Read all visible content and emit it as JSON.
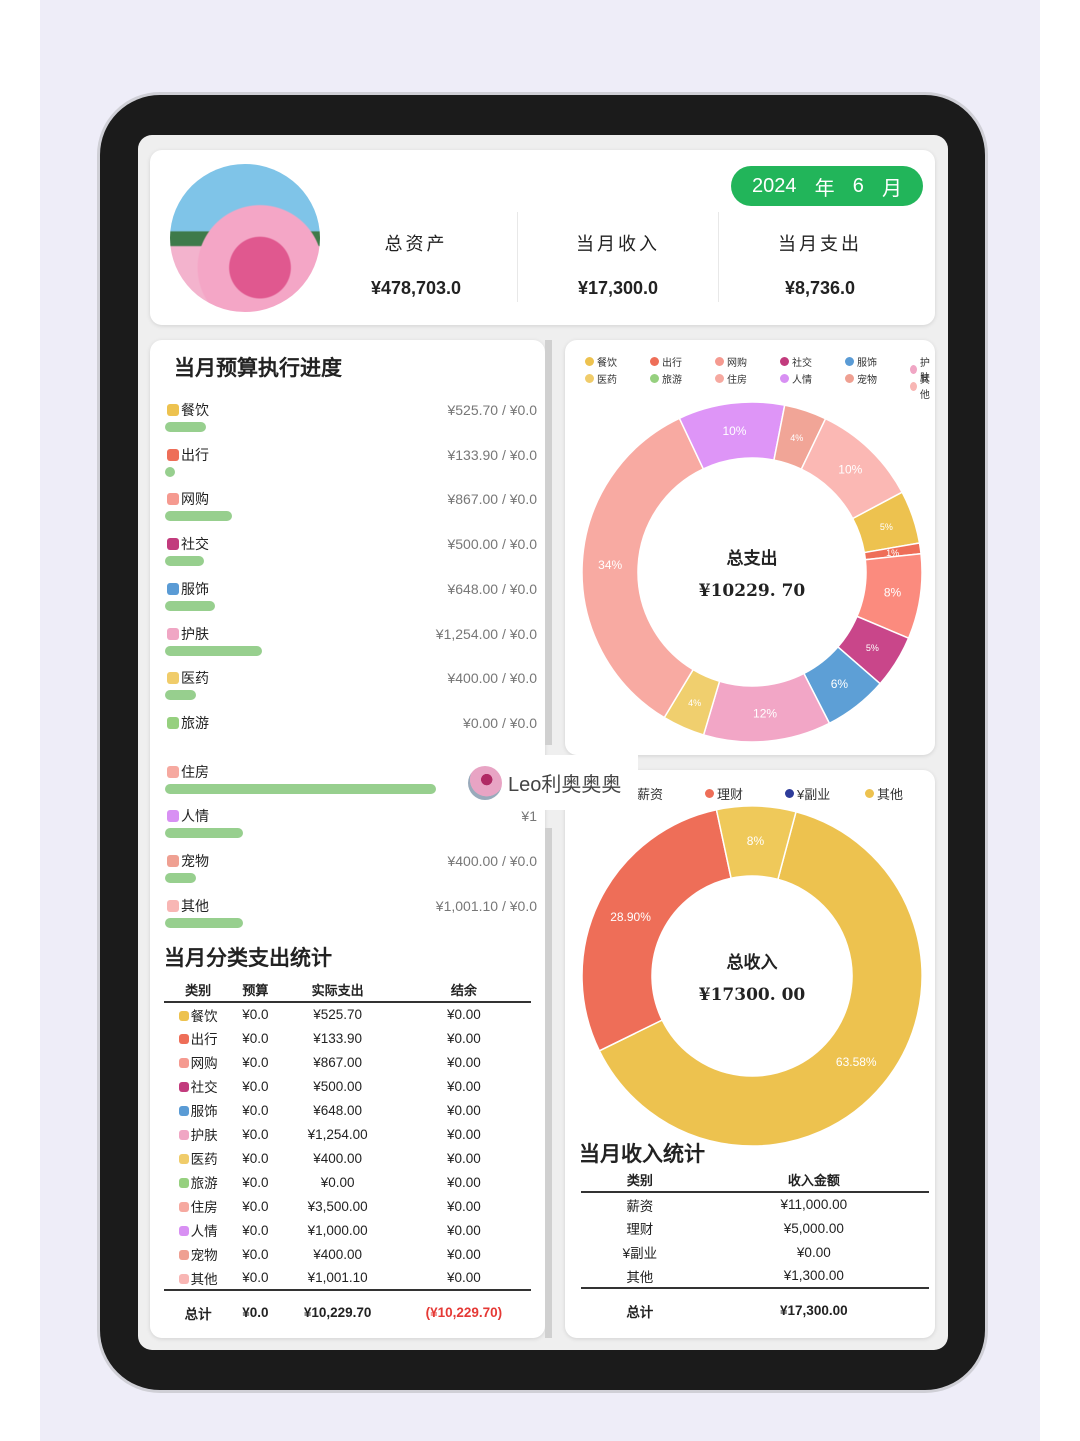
{
  "header": {
    "date": {
      "year": "2024",
      "year_unit": "年",
      "month": "6",
      "month_unit": "月"
    },
    "stats": [
      {
        "label": "总资产",
        "value": "¥478,703.0"
      },
      {
        "label": "当月收入",
        "value": "¥17,300.0"
      },
      {
        "label": "当月支出",
        "value": "¥8,736.0"
      }
    ]
  },
  "budget": {
    "title": "当月预算执行进度",
    "items": [
      {
        "label": "餐饮",
        "icon": "drumstick-icon",
        "amount": "¥525.70 / ¥0.0",
        "spent": 525.7
      },
      {
        "label": "出行",
        "icon": "car-icon",
        "amount": "¥133.90 / ¥0.0",
        "spent": 133.9
      },
      {
        "label": "网购",
        "icon": "cart-icon",
        "amount": "¥867.00 / ¥0.0",
        "spent": 867
      },
      {
        "label": "社交",
        "icon": "social-icon",
        "amount": "¥500.00 / ¥0.0",
        "spent": 500
      },
      {
        "label": "服饰",
        "icon": "shopping-bag-icon",
        "amount": "¥648.00 / ¥0.0",
        "spent": 648
      },
      {
        "label": "护肤",
        "icon": "lipstick-icon",
        "amount": "¥1,254.00 / ¥0.0",
        "spent": 1254
      },
      {
        "label": "医药",
        "icon": "pill-icon",
        "amount": "¥400.00 / ¥0.0",
        "spent": 400
      },
      {
        "label": "旅游",
        "icon": "beach-icon",
        "amount": "¥0.00 / ¥0.0",
        "spent": 0
      },
      {
        "label": "住房",
        "icon": "house-icon",
        "amount": "¥3",
        "spent": 3500
      },
      {
        "label": "人情",
        "icon": "gift-bowl-icon",
        "amount": "¥1",
        "spent": 1000
      },
      {
        "label": "宠物",
        "icon": "dog-icon",
        "amount": "¥400.00 / ¥0.0",
        "spent": 400
      },
      {
        "label": "其他",
        "icon": "sparkles-icon",
        "amount": "¥1,001.10 / ¥0.0",
        "spent": 1001.1
      }
    ]
  },
  "expense_table": {
    "title": "当月分类支出统计",
    "headers": [
      "类别",
      "预算",
      "实际支出",
      "结余"
    ],
    "rows": [
      [
        "餐饮",
        "¥0.0",
        "¥525.70",
        "¥0.00"
      ],
      [
        "出行",
        "¥0.0",
        "¥133.90",
        "¥0.00"
      ],
      [
        "网购",
        "¥0.0",
        "¥867.00",
        "¥0.00"
      ],
      [
        "社交",
        "¥0.0",
        "¥500.00",
        "¥0.00"
      ],
      [
        "服饰",
        "¥0.0",
        "¥648.00",
        "¥0.00"
      ],
      [
        "护肤",
        "¥0.0",
        "¥1,254.00",
        "¥0.00"
      ],
      [
        "医药",
        "¥0.0",
        "¥400.00",
        "¥0.00"
      ],
      [
        "旅游",
        "¥0.0",
        "¥0.00",
        "¥0.00"
      ],
      [
        "住房",
        "¥0.0",
        "¥3,500.00",
        "¥0.00"
      ],
      [
        "人情",
        "¥0.0",
        "¥1,000.00",
        "¥0.00"
      ],
      [
        "宠物",
        "¥0.0",
        "¥400.00",
        "¥0.00"
      ],
      [
        "其他",
        "¥0.0",
        "¥1,001.10",
        "¥0.00"
      ]
    ],
    "total": [
      "总计",
      "¥0.0",
      "¥10,229.70",
      "(¥10,229.70)"
    ],
    "negative_color": "#e53935"
  },
  "chart_data": [
    {
      "type": "pie",
      "center_label": "总支出",
      "center_value": "¥10229. 70",
      "legend": [
        "餐饮",
        "出行",
        "网购",
        "社交",
        "服饰",
        "护肤",
        "医药",
        "旅游",
        "住房",
        "人情",
        "宠物",
        "其他"
      ],
      "legend_colors": [
        "#edc24f",
        "#ee6e58",
        "#f59a90",
        "#c23b7d",
        "#5a9bd5",
        "#f0a6c4",
        "#f0cc6a",
        "#96d07f",
        "#f6a9a0",
        "#d890f3",
        "#efa092",
        "#f8b6b4"
      ],
      "slices": [
        {
          "name": "餐饮",
          "value": 5,
          "label": "5%",
          "color": "#edc24f"
        },
        {
          "name": "出行",
          "value": 1,
          "label": "1%",
          "color": "#ee6e58"
        },
        {
          "name": "网购",
          "value": 8,
          "label": "8%",
          "color": "#fb8b7e"
        },
        {
          "name": "社交",
          "value": 5,
          "label": "5%",
          "color": "#c9468a"
        },
        {
          "name": "服饰",
          "value": 6,
          "label": "6%",
          "color": "#5d9fd6"
        },
        {
          "name": "护肤",
          "value": 12,
          "label": "12%",
          "color": "#f2a6c6"
        },
        {
          "name": "医药",
          "value": 4,
          "label": "4%",
          "color": "#f0cf6e"
        },
        {
          "name": "住房",
          "value": 34,
          "label": "34%",
          "color": "#f8aaa2"
        },
        {
          "name": "人情",
          "value": 10,
          "label": "10%",
          "color": "#de95f7"
        },
        {
          "name": "宠物",
          "value": 4,
          "label": "4%",
          "color": "#f1a597"
        },
        {
          "name": "其他",
          "value": 10,
          "label": "10%",
          "color": "#fbb8b4"
        }
      ]
    },
    {
      "type": "pie",
      "center_label": "总收入",
      "center_value": "¥17300. 00",
      "legend": [
        "薪资",
        "理财",
        "¥副业",
        "其他"
      ],
      "legend_colors": [
        "#edc24f",
        "#ee6e58",
        "#2e3c9a",
        "#edc24f"
      ],
      "slices": [
        {
          "name": "薪资",
          "value": 63.58,
          "label": "63.58%",
          "color": "#edc24f"
        },
        {
          "name": "理财",
          "value": 28.9,
          "label": "28.90%",
          "color": "#ee6e58"
        },
        {
          "name": "其他",
          "value": 7.52,
          "label": "8%",
          "color": "#efc95a"
        }
      ]
    }
  ],
  "income_table": {
    "title": "当月收入统计",
    "headers": [
      "类别",
      "收入金额"
    ],
    "rows": [
      [
        "薪资",
        "¥11,000.00"
      ],
      [
        "理财",
        "¥5,000.00"
      ],
      [
        "¥副业",
        "¥0.00"
      ],
      [
        "其他",
        "¥1,300.00"
      ]
    ],
    "total": [
      "总计",
      "¥17,300.00"
    ]
  },
  "watermark": {
    "name": "Leo利奥奥奥"
  }
}
